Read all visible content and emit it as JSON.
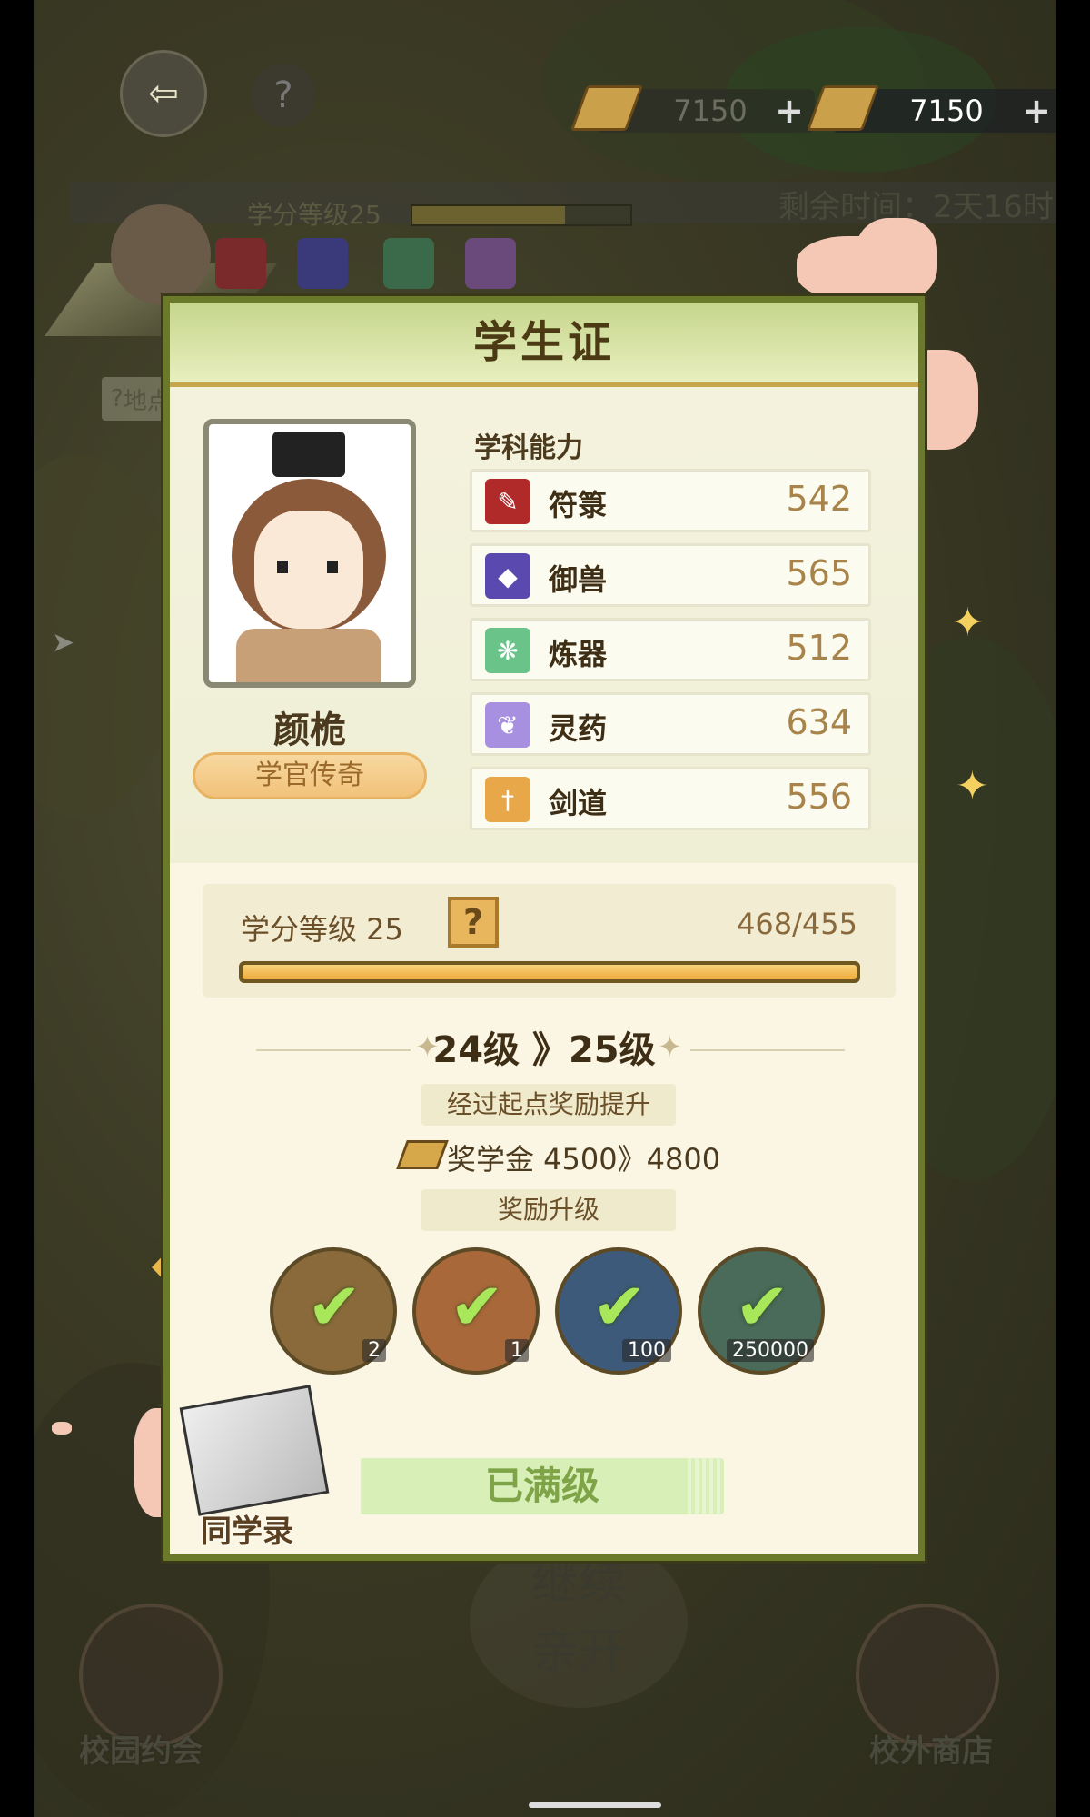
{
  "hud": {
    "back_icon": "back-arrow-icon",
    "help_icon": "question-icon",
    "currency_ghost": "7150",
    "currency_main": "7150",
    "currency_plus": "+"
  },
  "background": {
    "credit_level": "学分等级25",
    "remaining_time": "剩余时间：2天16时",
    "side_tab": "地点",
    "bottom_left_label": "校园约会",
    "bottom_right_label": "校外商店",
    "continue_label": "继续",
    "continue_label_2": "亲开"
  },
  "card": {
    "title": "学生证",
    "student_name": "颜桅",
    "student_title": "学官传奇",
    "abilities_header": "学科能力",
    "abilities": [
      {
        "name": "符箓",
        "value": "542",
        "icon": "talisman-icon",
        "color": "#b02a2a"
      },
      {
        "name": "御兽",
        "value": "565",
        "icon": "beast-icon",
        "color": "#5a4ab0"
      },
      {
        "name": "炼器",
        "value": "512",
        "icon": "artifact-icon",
        "color": "#6ac48a"
      },
      {
        "name": "灵药",
        "value": "634",
        "icon": "herb-icon",
        "color": "#a890e0"
      },
      {
        "name": "剑道",
        "value": "556",
        "icon": "sword-icon",
        "color": "#e8a84a"
      }
    ],
    "level": {
      "label": "学分等级  25",
      "help": "?",
      "progress_text": "468/455",
      "progress_fraction": 1.0
    },
    "transition": "24级 》25级",
    "badge_boost": "经过起点奖励提升",
    "scholarship": "奖学金  4500》4800",
    "badge_reward": "奖励升级",
    "rewards": [
      {
        "name": "token-reward",
        "qty": "2",
        "color": "#8a6a3a"
      },
      {
        "name": "bundle-reward",
        "qty": "1",
        "color": "#a8683a"
      },
      {
        "name": "key-reward",
        "qty": "100",
        "color": "#3e5a7a"
      },
      {
        "name": "coin-reward",
        "qty": "250000",
        "color": "#4a6a5a"
      }
    ],
    "classmates_label": "同学录",
    "maxed_label": "已满级"
  }
}
